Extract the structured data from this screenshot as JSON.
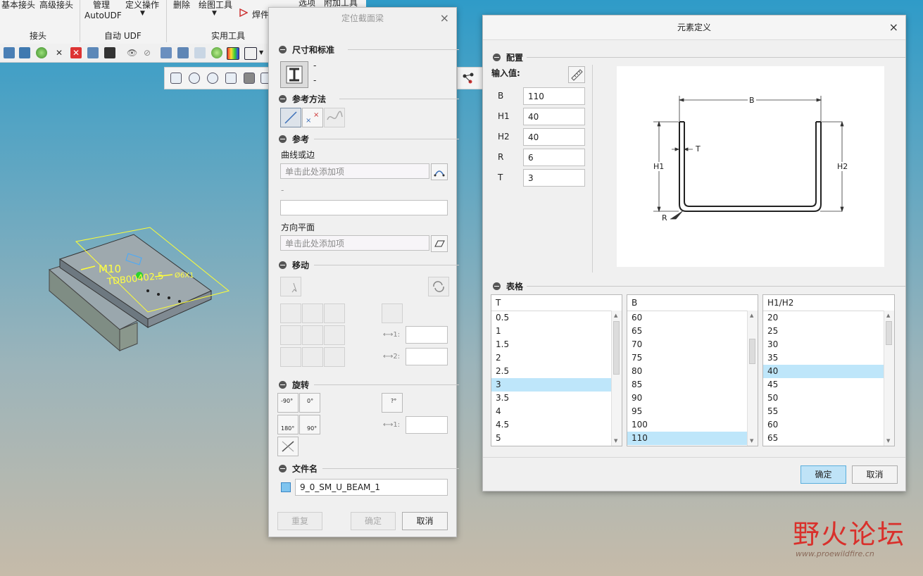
{
  "ribbon": {
    "row1": [
      "基本接头",
      "高级接头",
      "管理",
      "定义操作",
      "删除",
      "绘图工具",
      "焊件",
      "选项",
      "附加工具"
    ],
    "row2": [
      "AutoUDF"
    ],
    "groups": [
      "接头",
      "自动 UDF",
      "实用工具"
    ]
  },
  "viewport": {
    "annotation_m10": "M10",
    "annotation_part": "TDB00402.5",
    "annotation_6x": "Ø6X1"
  },
  "left_dialog": {
    "title": "定位截面梁",
    "close": "×",
    "sections": {
      "size": "尺寸和标准",
      "ref_method": "参考方法",
      "reference": "参考",
      "move": "移动",
      "rotate": "旋转",
      "filename": "文件名"
    },
    "size_dashes": [
      "-",
      "-"
    ],
    "curve_label": "曲线或边",
    "curve_placeholder": "单击此处添加项",
    "dash_label": "-",
    "second_field": "",
    "dir_plane_label": "方向平面",
    "dir_plane_placeholder": "单击此处添加项",
    "move_label_1": "1:",
    "move_label_2": "2:",
    "rot_label_1": "1:",
    "rot_buttons": [
      "-90°",
      "0°",
      "180°",
      "90°",
      "?°"
    ],
    "filename_value": "9_0_SM_U_BEAM_1",
    "buttons": {
      "reset": "重复",
      "ok": "确定",
      "cancel": "取消"
    }
  },
  "right_dialog": {
    "title": "元素定义",
    "close": "×",
    "section_config": "配置",
    "input_label": "输入值:",
    "params": [
      {
        "name": "B",
        "value": "110"
      },
      {
        "name": "H1",
        "value": "40"
      },
      {
        "name": "H2",
        "value": "40"
      },
      {
        "name": "R",
        "value": "6"
      },
      {
        "name": "T",
        "value": "3"
      }
    ],
    "diagram_labels": {
      "b": "B",
      "t": "T",
      "h1": "H1",
      "h2": "H2",
      "r": "R"
    },
    "section_table": "表格",
    "tables": [
      {
        "header": "T",
        "rows": [
          "0.5",
          "1",
          "1.5",
          "2",
          "2.5",
          "3",
          "3.5",
          "4",
          "4.5",
          "5"
        ],
        "selected": "3"
      },
      {
        "header": "B",
        "rows": [
          "60",
          "65",
          "70",
          "75",
          "80",
          "85",
          "90",
          "95",
          "100",
          "110"
        ],
        "selected": "110"
      },
      {
        "header": "H1/H2",
        "rows": [
          "20",
          "25",
          "30",
          "35",
          "40",
          "45",
          "50",
          "55",
          "60",
          "65"
        ],
        "selected": "40"
      }
    ],
    "buttons": {
      "ok": "确定",
      "cancel": "取消"
    }
  },
  "watermark": {
    "brand": "野火论坛",
    "url": "www.proewildfire.cn"
  },
  "colors": {
    "accent_selection": "#bee6fa",
    "primary_button": "#bfe3f7",
    "watermark_red": "#d9302b"
  }
}
